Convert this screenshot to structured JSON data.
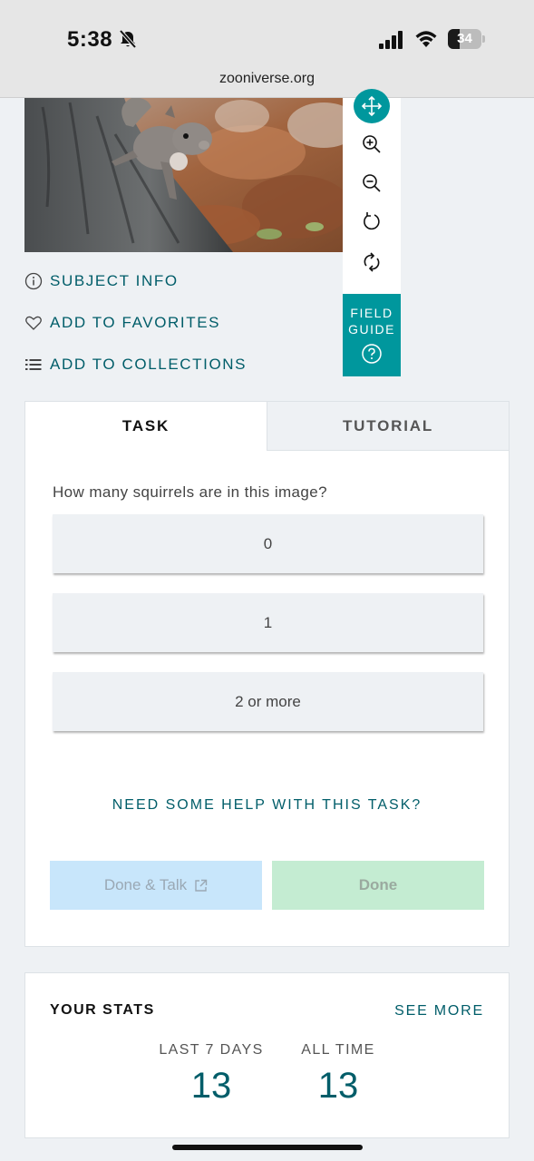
{
  "status_bar": {
    "time": "5:38",
    "battery": "34",
    "battery_level": 0.34,
    "url": "zooniverse.org"
  },
  "subject": {
    "toolbar_icons": [
      "move-icon",
      "zoom-in-icon",
      "zoom-out-icon",
      "rotate-icon",
      "reset-icon"
    ],
    "field_guide": {
      "line1": "FIELD",
      "line2": "GUIDE",
      "icon": "question-icon"
    }
  },
  "meta_links": [
    {
      "label": "SUBJECT INFO",
      "icon": "info-icon"
    },
    {
      "label": "ADD TO FAVORITES",
      "icon": "heart-icon"
    },
    {
      "label": "ADD TO COLLECTIONS",
      "icon": "list-icon"
    }
  ],
  "task": {
    "tabs": [
      {
        "label": "TASK"
      },
      {
        "label": "TUTORIAL"
      }
    ],
    "question": "How many squirrels are in this image?",
    "answers": [
      {
        "label": "0"
      },
      {
        "label": "1"
      },
      {
        "label": "2 or more"
      }
    ],
    "help_label": "NEED SOME HELP WITH THIS TASK?",
    "done_talk_label": "Done & Talk",
    "done_label": "Done"
  },
  "stats": {
    "title": "YOUR STATS",
    "see_more": "SEE MORE",
    "items": [
      {
        "label": "LAST 7 DAYS",
        "value": "13"
      },
      {
        "label": "ALL TIME",
        "value": "13"
      }
    ]
  },
  "colors": {
    "accent": "#00979d",
    "link": "#005d69",
    "talk_button": "#c8e6fb",
    "done_button": "#c4ecd2"
  }
}
